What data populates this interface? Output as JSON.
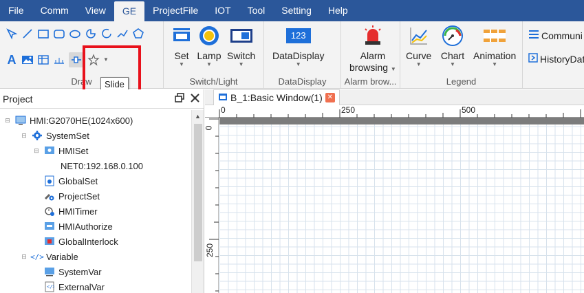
{
  "menu": {
    "items": [
      "File",
      "Comm",
      "View",
      "GE",
      "ProjectFile",
      "IOT",
      "Tool",
      "Setting",
      "Help"
    ],
    "active": "GE"
  },
  "ribbon": {
    "groups": {
      "draw": "Draw",
      "switch_light": "Switch/Light",
      "data_display": "DataDisplay",
      "alarm": "Alarm brow...",
      "legend": "Legend"
    },
    "buttons": {
      "set": "Set",
      "lamp": "Lamp",
      "switch": "Switch",
      "data_display": "DataDisplay",
      "data_display_icon_text": "123",
      "alarm_browsing_line1": "Alarm",
      "alarm_browsing_line2": "browsing",
      "curve": "Curve",
      "chart": "Chart",
      "animation": "Animation",
      "communication": "Communi",
      "history_data": "HistoryDat"
    }
  },
  "tooltip": "Slide",
  "project": {
    "title": "Project",
    "tree": [
      {
        "label": "HMI:G2070HE(1024x600)",
        "level": 0,
        "icon": "monitor-icon"
      },
      {
        "label": "SystemSet",
        "level": 1,
        "icon": "gear-icon"
      },
      {
        "label": "HMISet",
        "level": 2,
        "icon": "hmi-settings-icon"
      },
      {
        "label": "NET0:192.168.0.100",
        "level": 3,
        "icon": ""
      },
      {
        "label": "GlobalSet",
        "level": 2,
        "icon": "global-settings-icon"
      },
      {
        "label": "ProjectSet",
        "level": 2,
        "icon": "wrench-gear-icon"
      },
      {
        "label": "HMITimer",
        "level": 2,
        "icon": "timer-icon"
      },
      {
        "label": "HMIAuthorize",
        "level": 2,
        "icon": "authorize-icon"
      },
      {
        "label": "GlobalInterlock",
        "level": 2,
        "icon": "interlock-icon"
      },
      {
        "label": "Variable",
        "level": 1,
        "icon": "code-brackets-icon"
      },
      {
        "label": "SystemVar",
        "level": 2,
        "icon": "system-variable-icon"
      },
      {
        "label": "ExternalVar",
        "level": 2,
        "icon": "external-variable-icon"
      }
    ]
  },
  "editor": {
    "tab_label": "B_1:Basic Window(1)",
    "ruler_top": [
      "0",
      "250",
      "500"
    ],
    "ruler_left": [
      "0",
      "250"
    ]
  },
  "colors": {
    "menubar": "#2b579a",
    "highlight": "#e8111b",
    "accent_blue": "#1e6fd9"
  }
}
